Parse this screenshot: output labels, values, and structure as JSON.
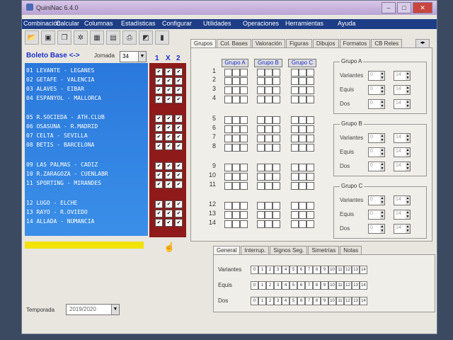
{
  "window": {
    "title": "QuiniNac 6.4.0"
  },
  "menu": [
    "Combinación",
    "Calcular",
    "Columnas",
    "Estadísticas",
    "Configurar",
    "Utilidades",
    "Operaciones",
    "Herramientas",
    "Ayuda"
  ],
  "boleto": {
    "title": "Boleto Base <->",
    "jornada_label": "Jornada",
    "jornada_value": "34",
    "col_headers": [
      "1",
      "X",
      "2"
    ]
  },
  "matches": [
    "01 LEVANTE - LEGANES",
    "02 GETAFE - VALENCIA",
    "03 ALAVES - EIBAR",
    "04 ESPANYOL - MALLORCA",
    "05 R.SOCIEDA - ATH.CLUB",
    "06 OSASUNA - R.MADRID",
    "07 CELTA - SEVILLA",
    "08 BETIS - BARCELONA",
    "09 LAS PALMAS - CADIZ",
    "10 R.ZARAGOZA - CUENLABR",
    "11 SPORTING - MIRANDES",
    "12 LUGO - ELCHE",
    "13 RAYO - R.OVIEDO",
    "14 ALLADA - NUMANCIA"
  ],
  "tabs": [
    "Grupos",
    "Col. Bases",
    "Valoración",
    "Figuras",
    "Dibujos",
    "Formatos",
    "CB Reles"
  ],
  "groups": {
    "buttons": [
      "Grupo A",
      "Grupo B",
      "Grupo C"
    ],
    "rows": [
      "1",
      "2",
      "3",
      "4",
      "5",
      "6",
      "7",
      "8",
      "9",
      "10",
      "11",
      "12",
      "13",
      "14"
    ],
    "panels": [
      {
        "title": "Grupo A",
        "labels": [
          "Variantes",
          "Equis",
          "Dos"
        ],
        "min": "0",
        "max": "14"
      },
      {
        "title": "Grupo B",
        "labels": [
          "Variantes",
          "Equis",
          "Dos"
        ],
        "min": "0",
        "max": "14"
      },
      {
        "title": "Grupo C",
        "labels": [
          "Variantes",
          "Equis",
          "Dos"
        ],
        "min": "0",
        "max": "14"
      }
    ]
  },
  "bottom_tabs": [
    "General",
    "Interrup.",
    "Signos Seg.",
    "Simetrías",
    "Notas"
  ],
  "bottom": {
    "labels": [
      "Variantes",
      "Equis",
      "Dos"
    ],
    "numbers": [
      "0",
      "1",
      "2",
      "3",
      "4",
      "5",
      "6",
      "7",
      "8",
      "9",
      "10",
      "11",
      "12",
      "13",
      "14"
    ]
  },
  "temporada": {
    "label": "Temporada",
    "value": "2019/2020"
  },
  "colors": {
    "menubar": "#1e3d86",
    "blue_panel": "#2a78dc",
    "red_panel": "#8e1a1a",
    "accent": "#1b2fc9"
  }
}
